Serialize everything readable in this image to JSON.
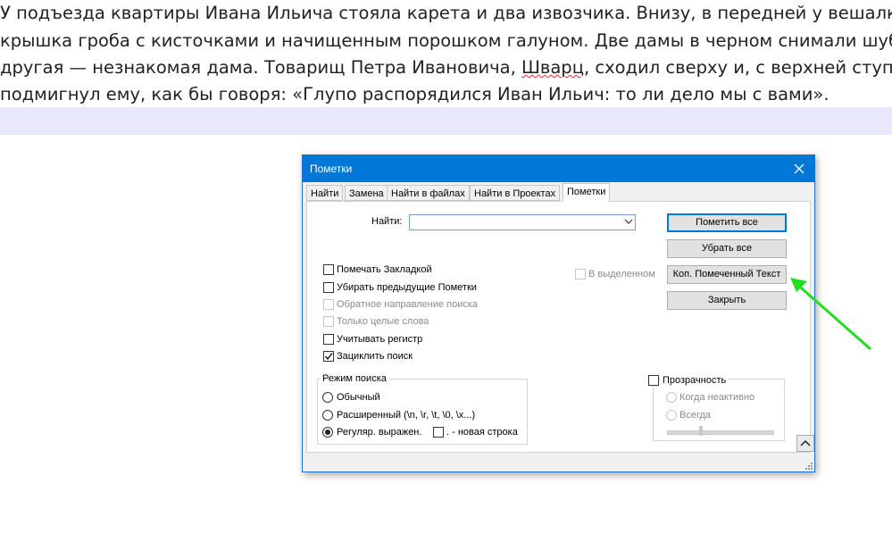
{
  "document": {
    "lines": [
      "У подъезда квартиры Ивана Ильича стояла карета и два извозчика. Внизу, в передней у вешалки",
      "крышка гроба с кисточками и начищенным порошком галуном. Две дамы в черном снимали шубы",
      "другая — незнакомая дама. Товарищ Петра Ивановича, Шварц, сходил сверху и, с верхней ступ",
      "подмигнул ему, как бы говоря: «Глупо распорядился Иван Ильич: то ли дело мы с вами»."
    ],
    "line3_parts": [
      "другая — незнакомая дама. Товарищ Петра Ивановича, ",
      "Шварц",
      ", сходил сверху и, с верхней ступ"
    ]
  },
  "dialog": {
    "title": "Пометки",
    "tabs": [
      "Найти",
      "Замена",
      "Найти в файлах",
      "Найти в Проектах",
      "Пометки"
    ],
    "active_tab": "Пометки",
    "find_label": "Найти:",
    "find_value": "",
    "buttons": {
      "mark_all": "Пометить все",
      "clear_all": "Убрать все",
      "copy_marked": "Коп. Помеченный Текст",
      "close": "Закрыть"
    },
    "in_selection": "В выделенном",
    "options": [
      {
        "label": "Помечать Закладкой",
        "checked": false,
        "enabled": true
      },
      {
        "label": "Убирать предыдущие Пометки",
        "checked": false,
        "enabled": true
      },
      {
        "label": "Обратное направление поиска",
        "checked": false,
        "enabled": false
      },
      {
        "label": "Только целые слова",
        "checked": false,
        "enabled": false
      },
      {
        "label": "Учитывать регистр",
        "checked": false,
        "enabled": true
      },
      {
        "label": "Зациклить поиск",
        "checked": true,
        "enabled": true
      }
    ],
    "search_mode": {
      "title": "Режим поиска",
      "options": [
        "Обычный",
        "Расширенный (\\n, \\r, \\t, \\0, \\x...)",
        "Регуляр. выражен."
      ],
      "selected": "Регуляр. выражен.",
      "newline_dot": ". - новая строка"
    },
    "transparency": {
      "title": "Прозрачность",
      "options": [
        "Когда неактивно",
        "Всегда"
      ]
    },
    "up_button": "^"
  },
  "colors": {
    "titlebar": "#0078d7",
    "arrow": "#22dd22",
    "highlight": "#e8e8fa"
  }
}
